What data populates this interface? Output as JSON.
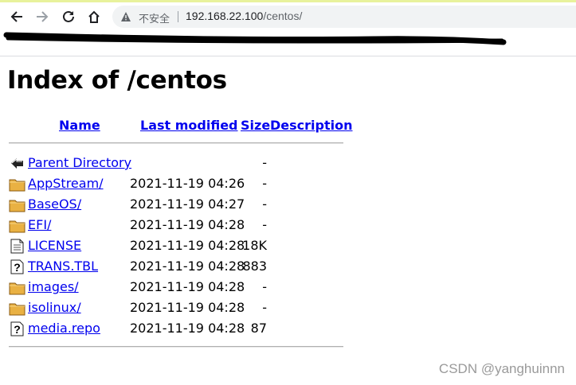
{
  "browser": {
    "insecure_label": "不安全",
    "url_host": "192.168.22.100",
    "url_path": "/centos/",
    "icons": {
      "back": "arrow-left-icon",
      "forward": "arrow-right-icon",
      "reload": "reload-icon",
      "home": "home-icon",
      "warning": "warning-triangle-icon"
    }
  },
  "page": {
    "title": "Index of /centos",
    "columns": {
      "name": "Name",
      "modified": "Last modified",
      "size": "Size",
      "description": "Description"
    },
    "rows": [
      {
        "icon": "back-arrow-icon",
        "name": "Parent Directory",
        "modified": "",
        "size": "-"
      },
      {
        "icon": "folder-icon",
        "name": "AppStream/",
        "modified": "2021-11-19 04:26",
        "size": "-"
      },
      {
        "icon": "folder-icon",
        "name": "BaseOS/",
        "modified": "2021-11-19 04:27",
        "size": "-"
      },
      {
        "icon": "folder-icon",
        "name": "EFI/",
        "modified": "2021-11-19 04:28",
        "size": "-"
      },
      {
        "icon": "text-file-icon",
        "name": "LICENSE",
        "modified": "2021-11-19 04:28",
        "size": "18K"
      },
      {
        "icon": "unknown-file-icon",
        "name": "TRANS.TBL",
        "modified": "2021-11-19 04:28",
        "size": "883"
      },
      {
        "icon": "folder-icon",
        "name": "images/",
        "modified": "2021-11-19 04:28",
        "size": "-"
      },
      {
        "icon": "folder-icon",
        "name": "isolinux/",
        "modified": "2021-11-19 04:28",
        "size": "-"
      },
      {
        "icon": "unknown-file-icon",
        "name": "media.repo",
        "modified": "2021-11-19 04:28",
        "size": "87"
      }
    ]
  },
  "watermark": "CSDN @yanghuinnn",
  "colors": {
    "link": "#0000ee",
    "omnibox": "#f1f3f4",
    "accent_line": "#e8f29c"
  }
}
